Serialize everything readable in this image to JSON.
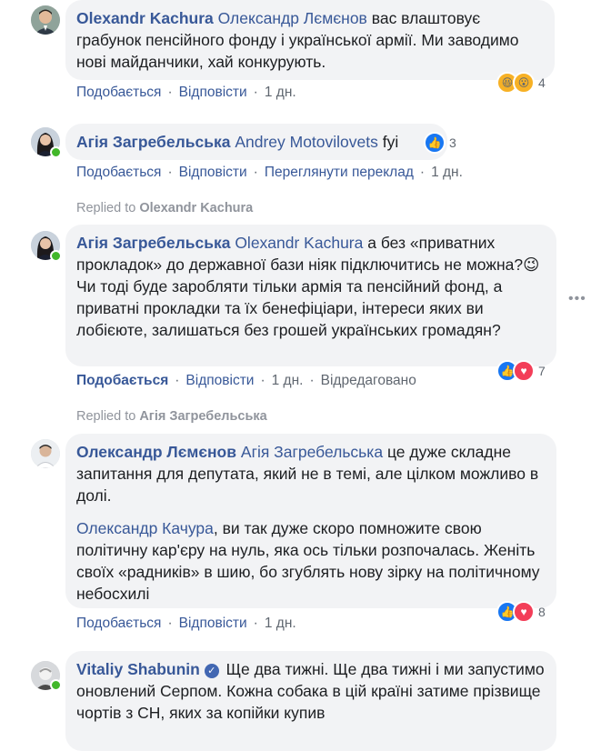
{
  "colors": {
    "link": "#385898",
    "meta": "#606770",
    "bubble": "#f2f3f5",
    "like": "#1877f2",
    "love": "#f33e58",
    "online": "#42b72a"
  },
  "comments": [
    {
      "author": "Olexandr Kachura",
      "mention": "Олександр Лємєнов",
      "text": "вас влаштовує грабунок пенсійного фонду і української армії. Ми заводимо нові майданчики, хай конкурують.",
      "reactions": {
        "icons": [
          "haha-icon",
          "wow-icon"
        ],
        "count": "4"
      },
      "actions": {
        "like": "Подобається",
        "reply": "Відповісти",
        "time": "1 дн."
      }
    },
    {
      "author": "Агія Загребельська",
      "mention": "Andrey Motovilovets",
      "text": "fyi",
      "reactions": {
        "icons": [
          "like-icon"
        ],
        "count": "3"
      },
      "actions": {
        "like": "Подобається",
        "reply": "Відповісти",
        "translate": "Переглянути переклад",
        "time": "1 дн."
      }
    },
    {
      "replied_prefix": "Replied to",
      "replied_to": "Olexandr Kachura",
      "author": "Агія Загребельська",
      "mention": "Olexandr Kachura",
      "text_before_emoji": "а без «приватних прокладок» до державної бази ніяк підключитись не можна?",
      "emoji": "😉",
      "text_after_emoji": "Чи тоді буде заробляти тільки армія та пенсійний фонд, а приватні прокладки та їх бенефіціари, інтереси яких ви лобієюте, залишаться без грошей українських громадян?",
      "reactions": {
        "icons": [
          "like-icon",
          "love-icon"
        ],
        "count": "7"
      },
      "actions": {
        "like": "Подобається",
        "reply": "Відповісти",
        "time": "1 дн.",
        "edited": "Відредаговано"
      }
    },
    {
      "replied_prefix": "Replied to",
      "replied_to": "Агія Загребельська",
      "author": "Олександр Лємєнов",
      "mention": "Агія Загребельська",
      "text": "це дуже складне запитання для депутата, який не в темі, але цілком можливо в долі.",
      "mention2": "Олександр Качура",
      "text2": ", ви так дуже скоро помножите свою політичну кар'єру на нуль, яка ось тільки розпочалась. Женіть своїх «радників» в шию, бо згублять нову зірку на політичному небосхилі",
      "reactions": {
        "icons": [
          "like-icon",
          "love-icon"
        ],
        "count": "8"
      },
      "actions": {
        "like": "Подобається",
        "reply": "Відповісти",
        "time": "1 дн."
      }
    },
    {
      "author": "Vitaliy Shabunin",
      "verified_icon": "verified-icon",
      "text": "Ще два тижні. Ще два тижні і ми запустимо оновлений Серпом. Кожна собака в цій країні затиме прізвище чортів з СН, яких за копійки купив"
    }
  ],
  "more_options_label": "•••"
}
